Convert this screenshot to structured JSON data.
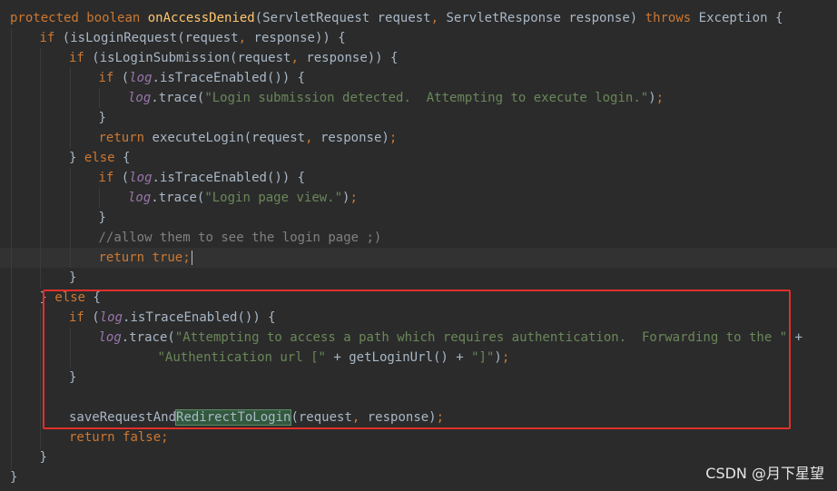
{
  "editor": {
    "lines": [
      {
        "indent": 0,
        "tokens": [
          {
            "c": "kw",
            "t": "protected "
          },
          {
            "c": "kw",
            "t": "boolean "
          },
          {
            "c": "fn",
            "t": "onAccessDenied"
          },
          {
            "c": "plain",
            "t": "(ServletRequest request"
          },
          {
            "c": "kw",
            "t": ", "
          },
          {
            "c": "plain",
            "t": "ServletResponse response) "
          },
          {
            "c": "kw",
            "t": "throws "
          },
          {
            "c": "plain",
            "t": "Exception {"
          }
        ]
      },
      {
        "indent": 1,
        "tokens": [
          {
            "c": "kw",
            "t": "if "
          },
          {
            "c": "plain",
            "t": "(isLoginRequest(request"
          },
          {
            "c": "kw",
            "t": ", "
          },
          {
            "c": "plain",
            "t": "response)) {"
          }
        ]
      },
      {
        "indent": 2,
        "tokens": [
          {
            "c": "kw",
            "t": "if "
          },
          {
            "c": "plain",
            "t": "(isLoginSubmission(request"
          },
          {
            "c": "kw",
            "t": ", "
          },
          {
            "c": "plain",
            "t": "response)) {"
          }
        ]
      },
      {
        "indent": 3,
        "tokens": [
          {
            "c": "kw",
            "t": "if "
          },
          {
            "c": "plain",
            "t": "("
          },
          {
            "c": "fld",
            "t": "log"
          },
          {
            "c": "plain",
            "t": ".isTraceEnabled()) {"
          }
        ]
      },
      {
        "indent": 4,
        "tokens": [
          {
            "c": "fld",
            "t": "log"
          },
          {
            "c": "plain",
            "t": ".trace("
          },
          {
            "c": "str",
            "t": "\"Login submission detected.  Attempting to execute login.\""
          },
          {
            "c": "plain",
            "t": ")"
          },
          {
            "c": "kw",
            "t": ";"
          }
        ]
      },
      {
        "indent": 3,
        "tokens": [
          {
            "c": "plain",
            "t": "}"
          }
        ]
      },
      {
        "indent": 3,
        "tokens": [
          {
            "c": "kw",
            "t": "return "
          },
          {
            "c": "plain",
            "t": "executeLogin(request"
          },
          {
            "c": "kw",
            "t": ", "
          },
          {
            "c": "plain",
            "t": "response)"
          },
          {
            "c": "kw",
            "t": ";"
          }
        ]
      },
      {
        "indent": 2,
        "tokens": [
          {
            "c": "plain",
            "t": "} "
          },
          {
            "c": "kw",
            "t": "else "
          },
          {
            "c": "plain",
            "t": "{"
          }
        ]
      },
      {
        "indent": 3,
        "tokens": [
          {
            "c": "kw",
            "t": "if "
          },
          {
            "c": "plain",
            "t": "("
          },
          {
            "c": "fld",
            "t": "log"
          },
          {
            "c": "plain",
            "t": ".isTraceEnabled()) {"
          }
        ]
      },
      {
        "indent": 4,
        "tokens": [
          {
            "c": "fld",
            "t": "log"
          },
          {
            "c": "plain",
            "t": ".trace("
          },
          {
            "c": "str",
            "t": "\"Login page view.\""
          },
          {
            "c": "plain",
            "t": ")"
          },
          {
            "c": "kw",
            "t": ";"
          }
        ]
      },
      {
        "indent": 3,
        "tokens": [
          {
            "c": "plain",
            "t": "}"
          }
        ]
      },
      {
        "indent": 3,
        "tokens": [
          {
            "c": "cmt",
            "t": "//allow them to see the login page ;)"
          }
        ]
      },
      {
        "indent": 3,
        "caret": true,
        "tokens": [
          {
            "c": "kw",
            "t": "return "
          },
          {
            "c": "kw",
            "t": "true;"
          }
        ]
      },
      {
        "indent": 2,
        "tokens": [
          {
            "c": "plain",
            "t": "}"
          }
        ]
      },
      {
        "indent": 1,
        "tokens": [
          {
            "c": "plain",
            "t": "} "
          },
          {
            "c": "kw",
            "t": "else "
          },
          {
            "c": "plain",
            "t": "{"
          }
        ]
      },
      {
        "indent": 2,
        "tokens": [
          {
            "c": "kw",
            "t": "if "
          },
          {
            "c": "plain",
            "t": "("
          },
          {
            "c": "fld",
            "t": "log"
          },
          {
            "c": "plain",
            "t": ".isTraceEnabled()) {"
          }
        ]
      },
      {
        "indent": 3,
        "tokens": [
          {
            "c": "fld",
            "t": "log"
          },
          {
            "c": "plain",
            "t": ".trace("
          },
          {
            "c": "str",
            "t": "\"Attempting to access a path which requires authentication.  Forwarding to the \" "
          },
          {
            "c": "plain",
            "t": "+"
          }
        ]
      },
      {
        "indent": 5,
        "tokens": [
          {
            "c": "str",
            "t": "\"Authentication url [\" "
          },
          {
            "c": "plain",
            "t": "+ getLoginUrl() + "
          },
          {
            "c": "str",
            "t": "\"]\""
          },
          {
            "c": "plain",
            "t": ")"
          },
          {
            "c": "kw",
            "t": ";"
          }
        ]
      },
      {
        "indent": 2,
        "tokens": [
          {
            "c": "plain",
            "t": "}"
          }
        ]
      },
      {
        "indent": 0,
        "tokens": []
      },
      {
        "indent": 2,
        "tokens": [
          {
            "c": "plain",
            "t": "saveRequestAnd"
          },
          {
            "c": "hl",
            "t": "RedirectToLogin"
          },
          {
            "c": "plain",
            "t": "(request"
          },
          {
            "c": "kw",
            "t": ", "
          },
          {
            "c": "plain",
            "t": "response)"
          },
          {
            "c": "kw",
            "t": ";"
          }
        ]
      },
      {
        "indent": 2,
        "tokens": [
          {
            "c": "kw",
            "t": "return "
          },
          {
            "c": "kw",
            "t": "false;"
          }
        ]
      },
      {
        "indent": 1,
        "tokens": [
          {
            "c": "plain",
            "t": "}"
          }
        ]
      },
      {
        "indent": 0,
        "tokens": [
          {
            "c": "plain",
            "t": "}"
          }
        ]
      }
    ]
  },
  "watermark": "CSDN @月下星望",
  "colors": {
    "background": "#2b2b2b",
    "keyword": "#cc7832",
    "function": "#ffc66d",
    "string": "#6a8759",
    "field": "#9876aa",
    "comment": "#808080",
    "text": "#a9b7c6",
    "annotation_border": "#e0302a"
  }
}
